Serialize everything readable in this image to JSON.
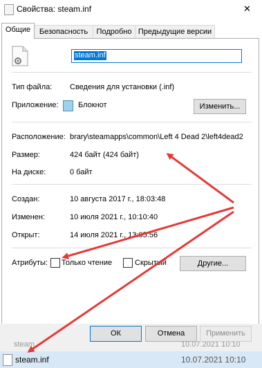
{
  "window": {
    "title": "Свойства: steam.inf",
    "close_glyph": "✕"
  },
  "tabs": [
    "Общие",
    "Безопасность",
    "Подробно",
    "Предыдущие версии"
  ],
  "general": {
    "filename": "steam.inf",
    "type_label": "Тип файла:",
    "type_value": "Сведения для установки (.inf)",
    "app_label": "Приложение:",
    "app_value": "Блокнот",
    "change_button": "Изменить...",
    "location_label": "Расположение:",
    "location_value": "brary\\steamapps\\common\\Left 4 Dead 2\\left4dead2",
    "size_label": "Размер:",
    "size_value": "424 байт (424 байт)",
    "disk_label": "На диске:",
    "disk_value": "0 байт",
    "created_label": "Создан:",
    "created_value": "10 августа 2017 г., 18:03:48",
    "modified_label": "Изменен:",
    "modified_value": "10 июля 2021 г., 10:10:40",
    "opened_label": "Открыт:",
    "opened_value": "14 июля 2021 г., 13:05:56",
    "attributes_label": "Атрибуты:",
    "readonly_label": "Только чтение",
    "hidden_label": "Скрытый",
    "other_button": "Другие..."
  },
  "footer": {
    "ok": "ОК",
    "cancel": "Отмена",
    "apply": "Применить",
    "behind_name": "steam",
    "behind_date": "10.07.2021 10:10",
    "explorer_name": "steam.inf",
    "explorer_date": "10.07.2021 10:10"
  },
  "colors": {
    "arrow": "#e53935",
    "accent": "#0078d7",
    "selection": "#0078d7"
  }
}
